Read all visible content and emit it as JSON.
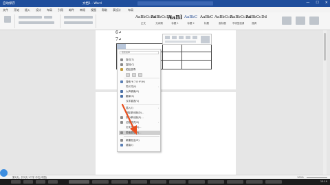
{
  "titlebar": {
    "autosave": "自动保存",
    "doc_title": "文档1 - Word",
    "search_placeholder": "搜索",
    "controls": [
      "—",
      "☐",
      "✕"
    ]
  },
  "ribbon_tabs": [
    "文件",
    "开始",
    "插入",
    "设计",
    "布局",
    "引用",
    "邮件",
    "审阅",
    "视图",
    "帮助",
    "表设计",
    "布局"
  ],
  "styles": [
    {
      "sample": "AaBbCcDd",
      "name": "正文",
      "big": false,
      "blue": false
    },
    {
      "sample": "AaBbCcDd",
      "name": "无间隔",
      "big": false,
      "blue": false
    },
    {
      "sample": "AaBl",
      "name": "标题 1",
      "big": true,
      "blue": false
    },
    {
      "sample": "AaBbC",
      "name": "标题 2",
      "big": false,
      "blue": true
    },
    {
      "sample": "AaBbC",
      "name": "标题",
      "big": false,
      "blue": false
    },
    {
      "sample": "AaBbCcD",
      "name": "副标题",
      "big": false,
      "blue": false
    },
    {
      "sample": "AaBbCcDd",
      "name": "不明显强调",
      "big": false,
      "blue": false
    },
    {
      "sample": "AaBbCcDd",
      "name": "强调",
      "big": false,
      "blue": false
    }
  ],
  "document": {
    "para1": "6↵",
    "para2": "7↵"
  },
  "context_menu": {
    "search_placeholder": "搜索菜单",
    "items": [
      {
        "label": "剪切(T)",
        "icon_color": "#8a8a8a",
        "arrow": false
      },
      {
        "label": "复制(C)",
        "icon_color": "#8a8a8a",
        "arrow": false
      },
      {
        "label": "粘贴选项:",
        "icon_color": "#c09a3a",
        "arrow": false
      },
      {
        "label": "",
        "icon_color": "",
        "arrow": false
      },
      {
        "label": "搜索\"6 7 8 9\"(H)",
        "icon_color": "#5a7fb5",
        "arrow": false
      },
      {
        "label": "同义词(Y)",
        "icon_color": "",
        "arrow": true
      },
      {
        "label": "大声朗读(R)",
        "icon_color": "#4a6fa5",
        "arrow": false
      },
      {
        "label": "翻译(S)",
        "icon_color": "#4a6fa5",
        "arrow": false
      },
      {
        "label": "汉字重选(V)",
        "icon_color": "",
        "arrow": false
      },
      {
        "label": "插入(I)",
        "icon_color": "",
        "arrow": true
      },
      {
        "label": "删除单元格(D)...",
        "icon_color": "",
        "arrow": false
      },
      {
        "label": "拆分单元格(P)...",
        "icon_color": "#8a8a8a",
        "arrow": false
      },
      {
        "label": "边框样式(B)",
        "icon_color": "#8a8a8a",
        "arrow": true
      },
      {
        "label": "文字方向(X)...",
        "icon_color": "",
        "arrow": false
      },
      {
        "label": "表格属性(R)...",
        "icon_color": "#8a8a8a",
        "arrow": false
      },
      {
        "label": "新建批注(M)",
        "icon_color": "#8a8a8a",
        "arrow": false
      },
      {
        "label": "链接(I)",
        "icon_color": "#5a7fb5",
        "arrow": false
      }
    ],
    "highlighted_index": 14
  },
  "statusbar": {
    "left": "第1页，共2页  1个字  中文(中国)",
    "zoom": "100%"
  },
  "taskbar": {
    "clock": "15:19"
  },
  "colors": {
    "accent": "#1f4e9c",
    "arrow": "#e8501f"
  }
}
